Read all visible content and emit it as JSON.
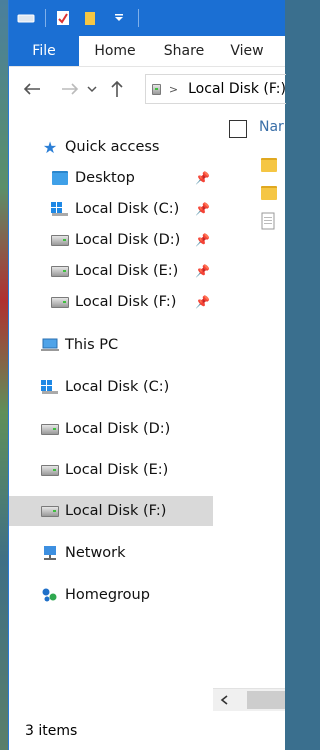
{
  "titlebar": {
    "quick_access_buttons": [
      "drive-icon",
      "properties-icon",
      "new-folder-icon",
      "customize-dropdown-icon"
    ]
  },
  "ribbon": {
    "tabs": [
      "File",
      "Home",
      "Share",
      "View"
    ]
  },
  "address": {
    "path": "Local Disk (F:)",
    "separator": ">"
  },
  "nav": {
    "quick_access": {
      "label": "Quick access",
      "items": [
        {
          "label": "Desktop",
          "icon": "folder-icon"
        },
        {
          "label": "Local Disk (C:)",
          "icon": "windows-drive-icon"
        },
        {
          "label": "Local Disk (D:)",
          "icon": "drive-icon"
        },
        {
          "label": "Local Disk (E:)",
          "icon": "drive-icon"
        },
        {
          "label": "Local Disk (F:)",
          "icon": "drive-icon"
        }
      ]
    },
    "this_pc": {
      "label": "This PC"
    },
    "drives": [
      {
        "label": "Local Disk (C:)"
      },
      {
        "label": "Local Disk (D:)"
      },
      {
        "label": "Local Disk (E:)"
      },
      {
        "label": "Local Disk (F:)"
      }
    ],
    "network": {
      "label": "Network"
    },
    "homegroup": {
      "label": "Homegroup"
    }
  },
  "content": {
    "column_header": "Nar"
  },
  "status": {
    "items_count": "3 items"
  },
  "colors": {
    "accent": "#1b6fd3",
    "selected": "#d9d9d9"
  }
}
